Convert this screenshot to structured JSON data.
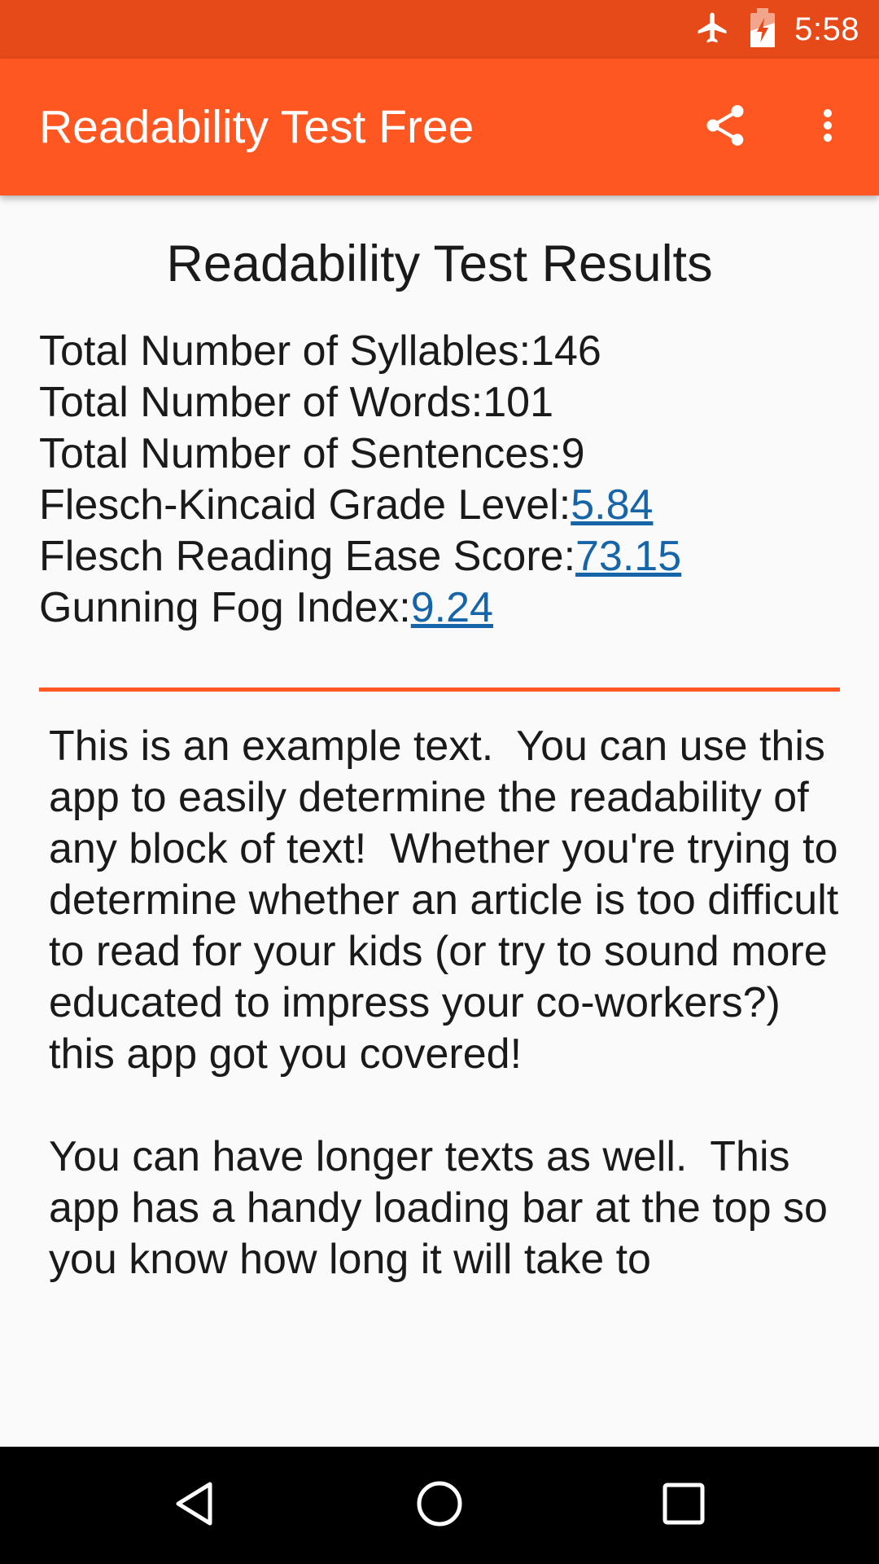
{
  "status_bar": {
    "time": "5:58",
    "icons": [
      "airplane-mode-icon",
      "battery-charging-icon"
    ]
  },
  "app_bar": {
    "title": "Readability Test Free",
    "actions": [
      "share-icon",
      "more-vert-icon"
    ],
    "colors": {
      "app_bar": "#ff5722",
      "status_bar": "#e64a19"
    }
  },
  "results": {
    "heading": "Readability Test Results",
    "syllables_label": "Total Number of Syllables:",
    "syllables_value": "146",
    "words_label": "Total Number of Words:",
    "words_value": "101",
    "sentences_label": "Total Number of Sentences:",
    "sentences_value": "9",
    "fk_grade_label": "Flesch-Kincaid Grade Level:",
    "fk_grade_value": "5.84",
    "reading_ease_label": "Flesch Reading Ease Score:",
    "reading_ease_value": "73.15",
    "gunning_fog_label": "Gunning Fog Index:",
    "gunning_fog_value": "9.24",
    "link_color": "#1565a8"
  },
  "sample_text": "This is an example text.  You can use this app to easily determine the readability of any block of text!  Whether you're trying to determine whether an article is too difficult to read for your kids (or try to sound more educated to impress your co-workers?) this app got you covered!\n\nYou can have longer texts as well.  This app has a handy loading bar at the top so you know how long it will take to",
  "nav_bar": {
    "buttons": [
      "back-icon",
      "home-icon",
      "recents-icon"
    ]
  }
}
